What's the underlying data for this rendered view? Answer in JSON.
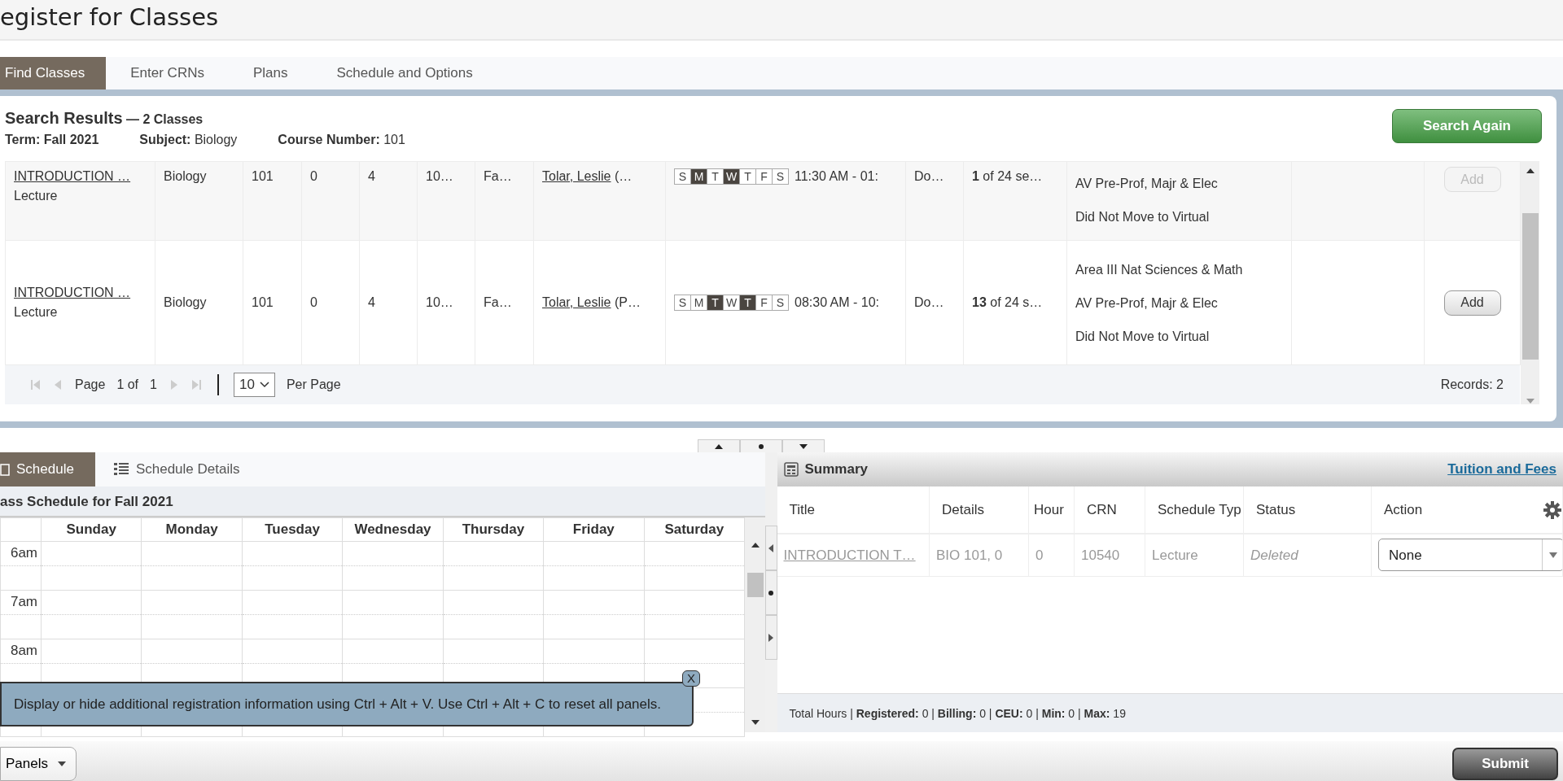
{
  "page_title": "egister for Classes",
  "tabs": [
    {
      "label": "Find Classes",
      "selected": true
    },
    {
      "label": "Enter CRNs",
      "selected": false
    },
    {
      "label": "Plans",
      "selected": false
    },
    {
      "label": "Schedule and Options",
      "selected": false
    }
  ],
  "search": {
    "title": "Search Results",
    "count": "— 2 Classes",
    "criteria": [
      {
        "text": "Term: Fall 2021",
        "bold": true
      },
      {
        "text": "**Subject:** Biology",
        "bold": false
      },
      {
        "text": "**Course Number:** 101",
        "bold": false
      }
    ],
    "button": "Search Again"
  },
  "results": {
    "rows": [
      {
        "title": "INTRODUCTION …",
        "schedule_type": "Lecture",
        "subject": "Biology",
        "course": "101",
        "section": "0",
        "hours": "4",
        "crn": "10…",
        "term": "Fa…",
        "instructor": "Tolar, Leslie",
        "instructor_more": "(…",
        "days": [
          {
            "label": "S",
            "selected": false
          },
          {
            "label": "M",
            "selected": true
          },
          {
            "label": "T",
            "selected": false
          },
          {
            "label": "W",
            "selected": true
          },
          {
            "label": "T",
            "selected": false
          },
          {
            "label": "F",
            "selected": false
          },
          {
            "label": "S",
            "selected": false
          }
        ],
        "time": "11:30 AM - 01:",
        "campus": "Do…",
        "status": "**1** of 24 se…",
        "attributes": [
          "AV Pre-Prof, Majr & Elec",
          "Did Not Move to Virtual"
        ],
        "action": {
          "label": "Add",
          "disabled": true
        }
      },
      {
        "title": "INTRODUCTION …",
        "schedule_type": "Lecture",
        "subject": "Biology",
        "course": "101",
        "section": "0",
        "hours": "4",
        "crn": "10…",
        "term": "Fa…",
        "instructor": "Tolar, Leslie",
        "instructor_more": "(P…",
        "days": [
          {
            "label": "S",
            "selected": false
          },
          {
            "label": "M",
            "selected": false
          },
          {
            "label": "T",
            "selected": true
          },
          {
            "label": "W",
            "selected": false
          },
          {
            "label": "T",
            "selected": true
          },
          {
            "label": "F",
            "selected": false
          },
          {
            "label": "S",
            "selected": false
          }
        ],
        "time": "08:30 AM - 10:",
        "campus": "Do…",
        "status": "**13** of 24 s…",
        "attributes": [
          "Area III Nat Sciences & Math",
          "AV Pre-Prof, Majr & Elec",
          "Did Not Move to Virtual"
        ],
        "action": {
          "label": "Add",
          "disabled": false
        }
      }
    ],
    "pager": {
      "page_label": "Page",
      "page_of": "1 of",
      "page_total": "1",
      "per_page": "10",
      "per_page_label": "Per Page",
      "records": "Records: 2"
    }
  },
  "schedule_tabs": [
    {
      "label": "Schedule",
      "selected": true
    },
    {
      "label": "Schedule Details",
      "selected": false
    }
  ],
  "schedule": {
    "heading": "ass Schedule for Fall 2021",
    "days": [
      "Sunday",
      "Monday",
      "Tuesday",
      "Wednesday",
      "Thursday",
      "Friday",
      "Saturday"
    ],
    "hours": [
      "6am",
      "7am",
      "8am"
    ]
  },
  "tooltip": {
    "text": "Display or hide additional registration information using Ctrl + Alt + V. Use Ctrl + Alt + C to reset all panels.",
    "close": "X"
  },
  "summary": {
    "title": "Summary",
    "link": "Tuition and Fees",
    "columns": [
      "Title",
      "Details",
      "Hour",
      "CRN",
      "Schedule Typ",
      "Status",
      "Action"
    ],
    "rows": [
      {
        "title": "INTRODUCTION T…",
        "details": "BIO 101, 0",
        "hours": "0",
        "crn": "10540",
        "schedule_type": "Lecture",
        "status": "Deleted",
        "action": "None"
      }
    ],
    "footer": "Total Hours | **Registered:** 0 | **Billing:** 0 | **CEU:** 0 | **Min:** 0 | **Max:** 19"
  },
  "bottom_bar": {
    "panels_button": "Panels",
    "submit_button": "Submit"
  }
}
